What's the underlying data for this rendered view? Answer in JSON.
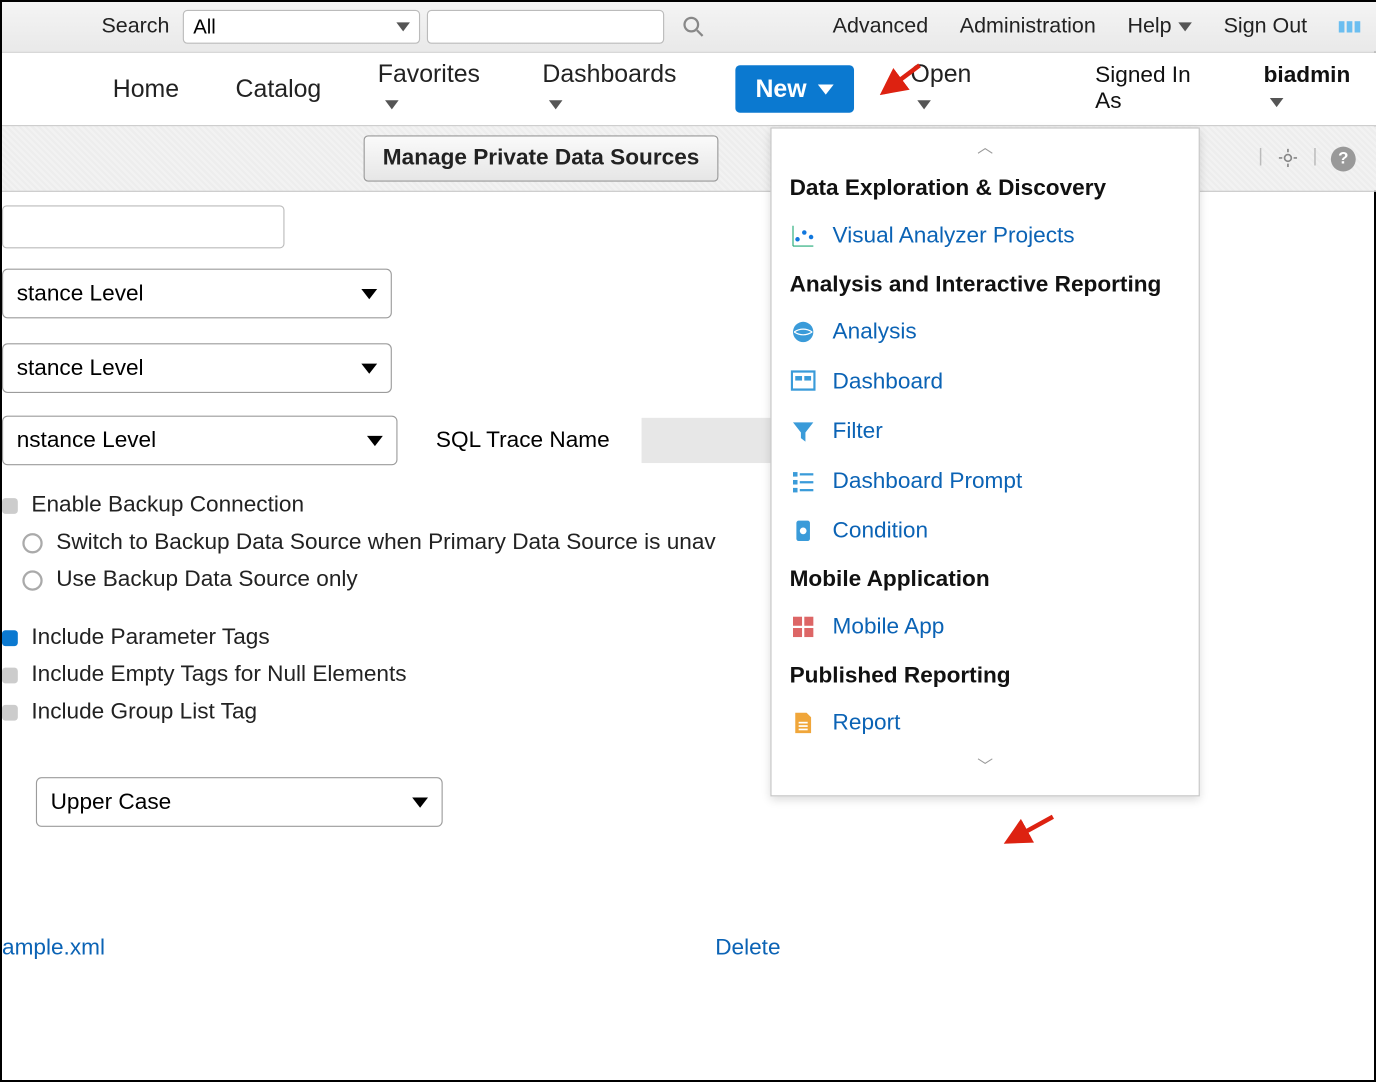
{
  "topbar": {
    "search_label": "Search",
    "search_select_value": "All",
    "links": {
      "advanced": "Advanced",
      "administration": "Administration",
      "help": "Help",
      "signout": "Sign Out"
    }
  },
  "navbar": {
    "home": "Home",
    "catalog": "Catalog",
    "favorites": "Favorites",
    "dashboards": "Dashboards",
    "new": "New",
    "open": "Open",
    "signed_in_as": "Signed In As",
    "user": "biadmin"
  },
  "subbar": {
    "manage_btn": "Manage Private Data Sources"
  },
  "content": {
    "level1": "stance Level",
    "level2": "stance Level",
    "level3": "nstance Level",
    "sql_trace_label": "SQL Trace Name",
    "enable_backup": "Enable Backup Connection",
    "switch_backup": "Switch to Backup Data Source when Primary Data Source is unav",
    "use_backup_only": "Use Backup Data Source only",
    "include_param": "Include Parameter Tags",
    "include_empty": "Include Empty Tags for Null Elements",
    "include_group": "Include Group List Tag",
    "case_sel": "Upper Case",
    "sample_link": "ample.xml",
    "delete_link": "Delete"
  },
  "dropdown": {
    "sect1": "Data Exploration & Discovery",
    "vap": "Visual Analyzer Projects",
    "sect2": "Analysis and Interactive Reporting",
    "analysis": "Analysis",
    "dashboard": "Dashboard",
    "filter": "Filter",
    "dprompt": "Dashboard Prompt",
    "condition": "Condition",
    "sect3": "Mobile Application",
    "mobile": "Mobile App",
    "sect4": "Published Reporting",
    "report": "Report"
  }
}
